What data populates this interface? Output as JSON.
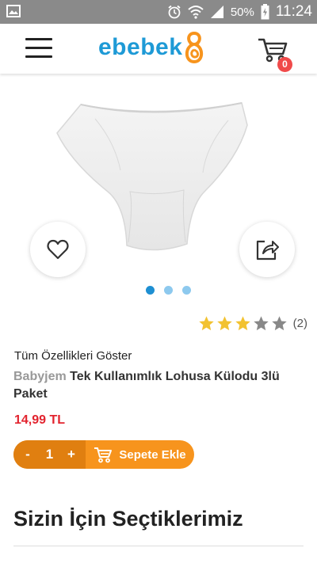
{
  "status_bar": {
    "battery_pct": "50%",
    "time": "11:24"
  },
  "header": {
    "logo_text": "ebebek",
    "cart_count": "0",
    "brand_color": "#1e9ad6"
  },
  "gallery": {
    "dot_count": 3,
    "active_dot": 0
  },
  "product": {
    "rating": 3,
    "rating_max": 5,
    "rating_count": "(2)",
    "show_all_features": "Tüm Özellikleri Göster",
    "brand": "Babyjem",
    "name": " Tek Kullanımlık Lohusa Külodu 3lü Paket",
    "price": "14,99 TL",
    "quantity": "1",
    "minus_label": "-",
    "plus_label": "+",
    "add_to_cart_label": "Sepete Ekle"
  },
  "section": {
    "title": "Sizin İçin Seçtiklerimiz"
  },
  "colors": {
    "accent_orange": "#f7941d",
    "price_red": "#e2232e",
    "star_filled": "#f2c230",
    "star_empty": "#888888"
  }
}
